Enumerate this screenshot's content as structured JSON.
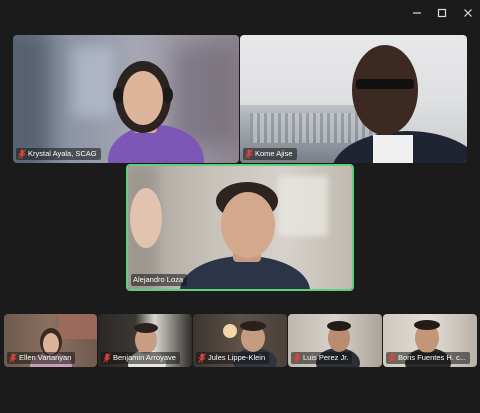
{
  "window": {
    "controls": [
      "minimize-icon",
      "maximize-icon",
      "close-icon"
    ]
  },
  "participants": {
    "p1": {
      "name": "Krystal Ayala, SCAG",
      "muted": true
    },
    "p2": {
      "name": "Kome Ajise",
      "muted": true
    },
    "p3": {
      "name": "Alejandro Loza",
      "muted": false,
      "active_speaker": true
    },
    "p4": {
      "name": "Ellen Vartanyan",
      "muted": true
    },
    "p5": {
      "name": "Benjamin Arroyave",
      "muted": true
    },
    "p6": {
      "name": "Jules Lippe-Klein",
      "muted": true
    },
    "p7": {
      "name": "Luis Perez Jr.",
      "muted": true
    },
    "p8": {
      "name": "Boris Fuentes H. c...",
      "muted": true
    }
  },
  "colors": {
    "background": "#1b1b1b",
    "active_border": "#5fd07a",
    "muted_mic": "#e0453a"
  }
}
